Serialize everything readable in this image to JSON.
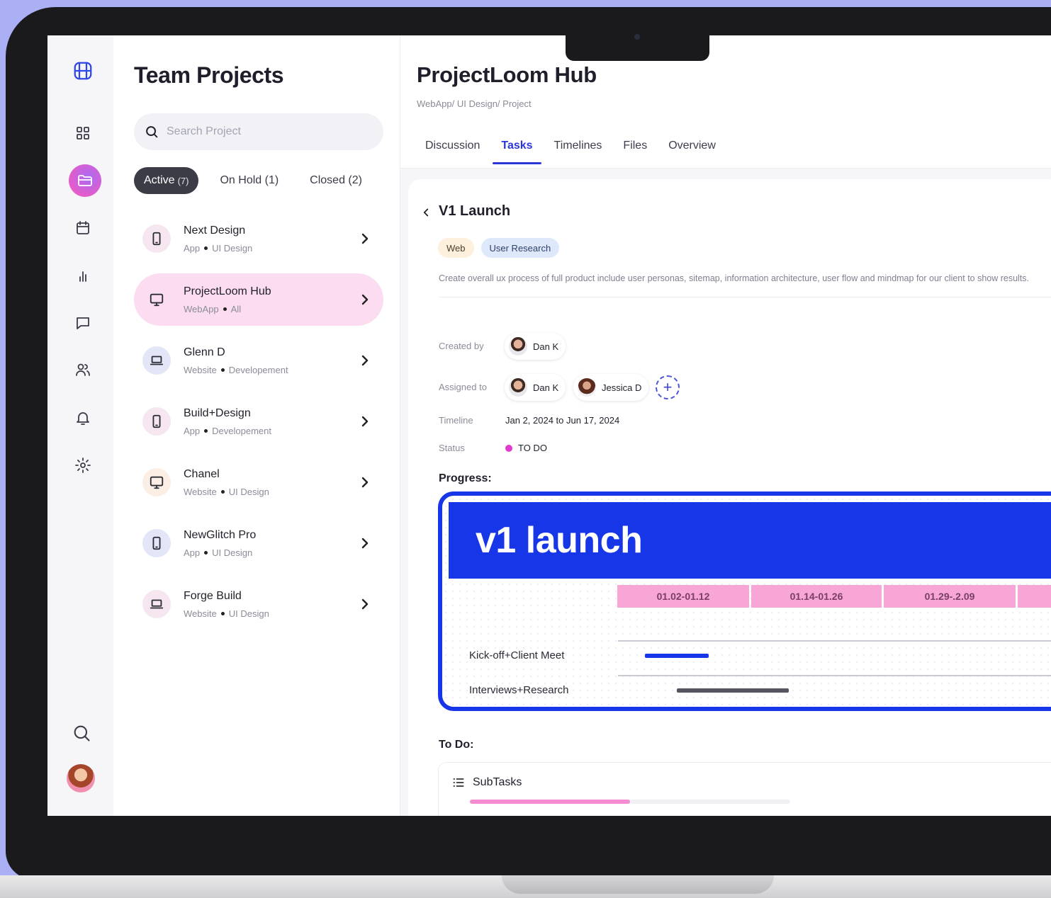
{
  "rail": {
    "icons": [
      "logo-icon",
      "dashboard-icon",
      "folder-icon",
      "calendar-icon",
      "chart-icon",
      "chat-icon",
      "users-icon",
      "bell-icon",
      "settings-icon",
      "search-icon",
      "avatar"
    ]
  },
  "projects": {
    "title": "Team Projects",
    "search_placeholder": "Search Project",
    "filters": [
      {
        "label": "Active",
        "count": "(7)"
      },
      {
        "label": "On Hold (1)"
      },
      {
        "label": "Closed (2)"
      }
    ],
    "items": [
      {
        "name": "Next Design",
        "type": "App",
        "category": "UI Design",
        "icon": "phone-icon"
      },
      {
        "name": "ProjectLoom Hub",
        "type": "WebApp",
        "category": "All",
        "icon": "monitor-icon"
      },
      {
        "name": "Glenn D",
        "type": "Website",
        "category": "Developement",
        "icon": "laptop-icon"
      },
      {
        "name": "Build+Design",
        "type": "App",
        "category": "Developement",
        "icon": "phone-icon"
      },
      {
        "name": "Chanel",
        "type": "Website",
        "category": "UI Design",
        "icon": "monitor-icon"
      },
      {
        "name": "NewGlitch Pro",
        "type": "App",
        "category": "UI Design",
        "icon": "phone-icon"
      },
      {
        "name": "Forge Build",
        "type": "Website",
        "category": "UI Design",
        "icon": "laptop-icon"
      }
    ]
  },
  "main": {
    "title": "ProjectLoom Hub",
    "breadcrumb": "WebApp/ UI Design/ Project",
    "tabs": [
      "Discussion",
      "Tasks",
      "Timelines",
      "Files",
      "Overview"
    ],
    "active_tab": "Tasks"
  },
  "task": {
    "title": "V1 Launch",
    "tags": [
      "Web",
      "User Research"
    ],
    "description": "Create overall ux process of full product include user personas, sitemap, information architecture, user flow and mindmap for our client to show results.",
    "created_label": "Created by",
    "created_by": "Dan K",
    "assigned_label": "Assigned to",
    "assigned": [
      "Dan K",
      "Jessica D"
    ],
    "timeline_label": "Timeline",
    "timeline": "Jan 2, 2024 to Jun 17, 2024",
    "status_label": "Status",
    "status": "TO DO",
    "status_color": "#e23ad0",
    "progress_label": "Progress:",
    "todo_label": "To Do:",
    "subtasks_label": "SubTasks",
    "subtasks_progress": 0.5
  },
  "gantt": {
    "banner": "v1 launch",
    "columns": [
      "01.02-01.12",
      "01.14-01.26",
      "01.29-.2.09",
      ""
    ],
    "rows": [
      {
        "label": "Kick-off+Client Meet",
        "color": "#1736e8"
      },
      {
        "label": "Interviews+Research",
        "color": "#555660"
      }
    ]
  }
}
